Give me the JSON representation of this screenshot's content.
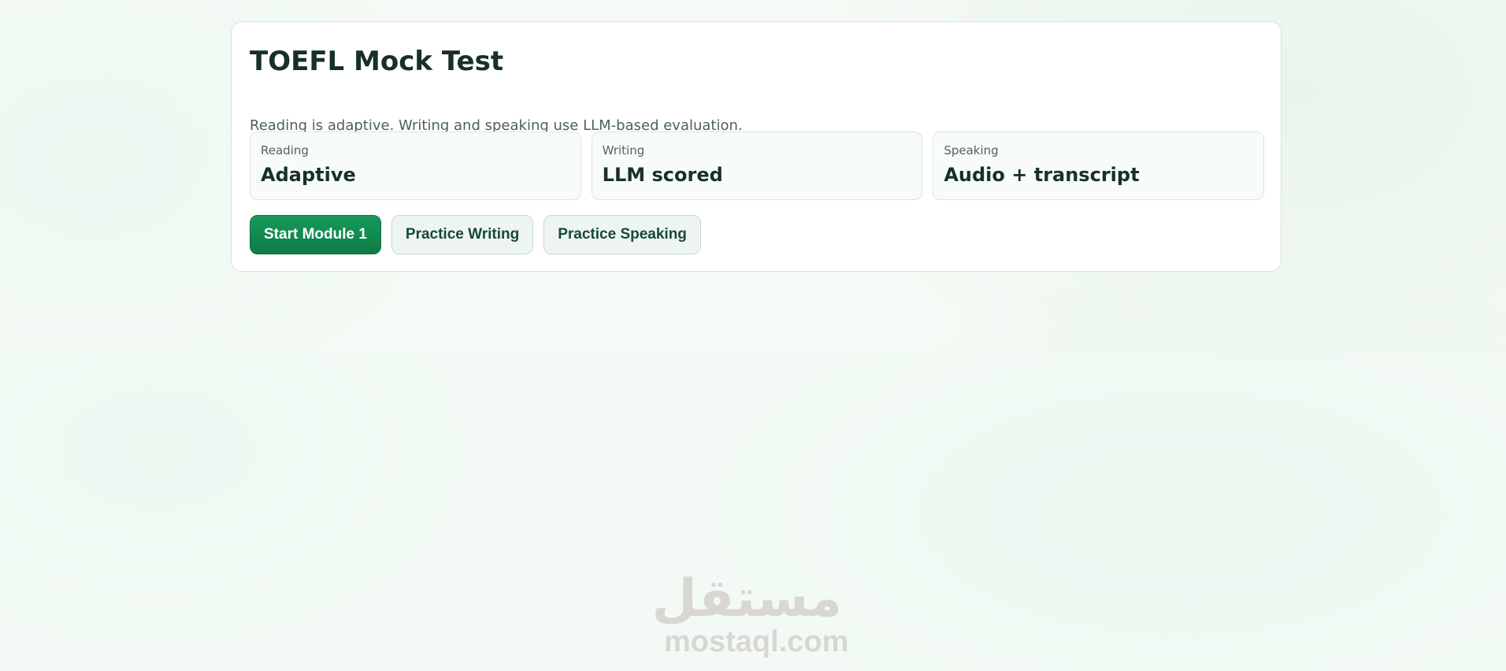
{
  "page": {
    "title": "TOEFL Mock Test",
    "description": "Reading is adaptive. Writing and speaking use LLM-based evaluation."
  },
  "stats": [
    {
      "label": "Reading",
      "value": "Adaptive"
    },
    {
      "label": "Writing",
      "value": "LLM scored"
    },
    {
      "label": "Speaking",
      "value": "Audio + transcript"
    }
  ],
  "actions": {
    "start_module": "Start Module 1",
    "practice_writing": "Practice Writing",
    "practice_speaking": "Practice Speaking"
  },
  "watermark": {
    "arabic": "مستقل",
    "latin": "mostaql.com"
  },
  "colors": {
    "primary": "#0f7b46",
    "secondary_bg": "#eef5f1",
    "text_dark": "#17302a",
    "background": "#f4faf5"
  }
}
